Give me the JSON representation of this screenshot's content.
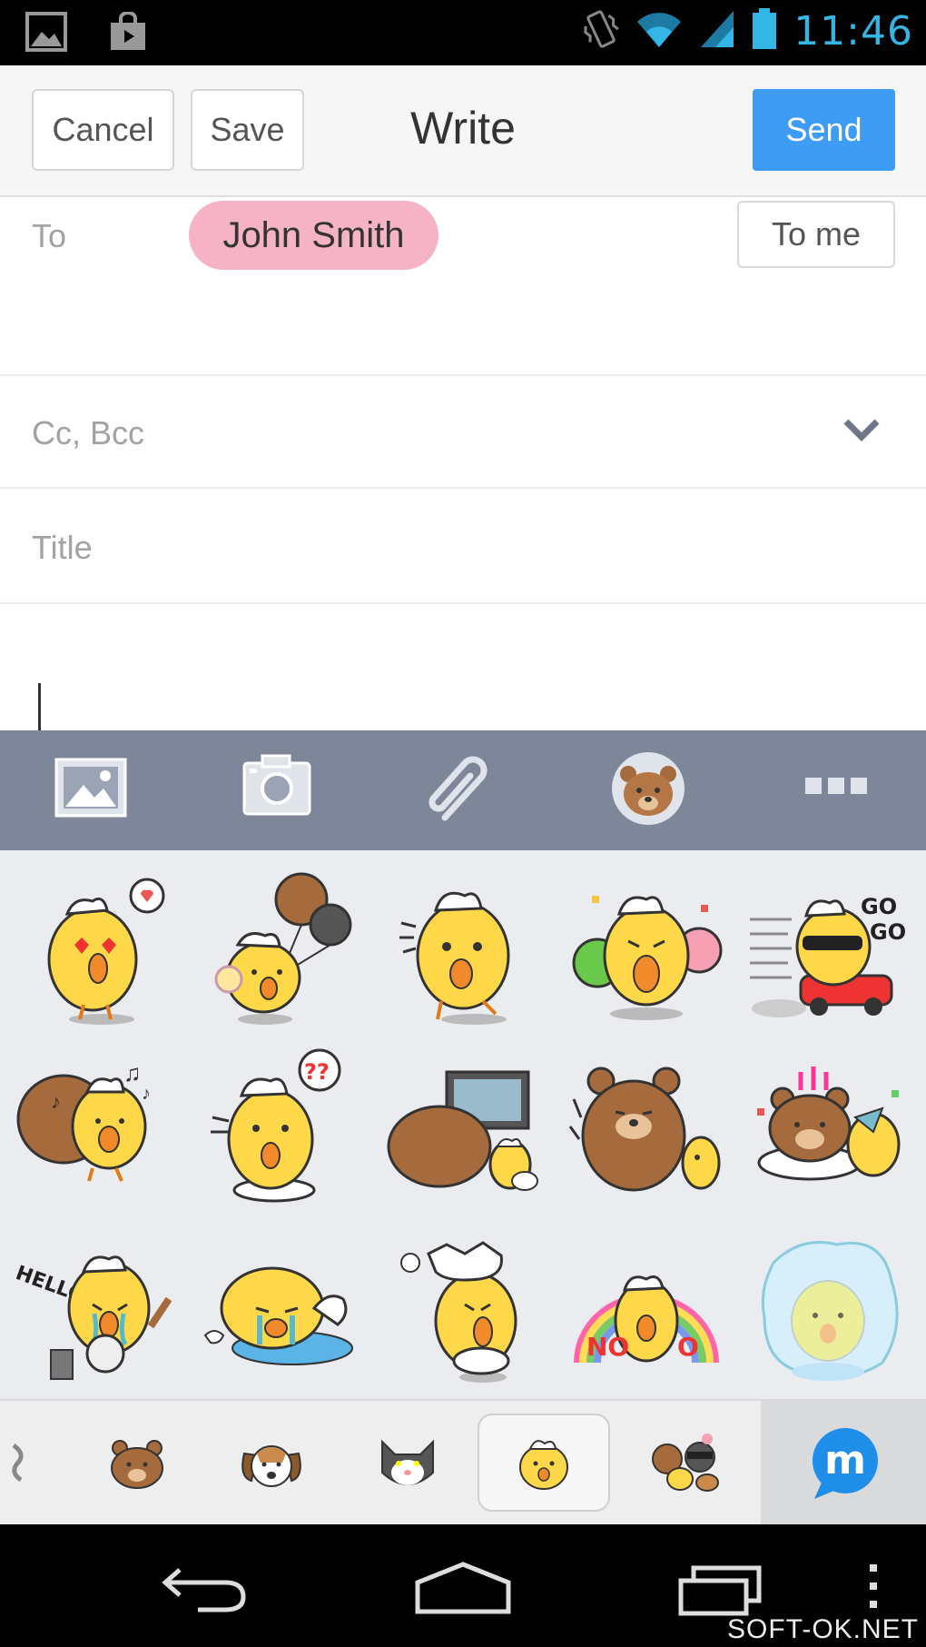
{
  "status_bar": {
    "time": "11:46",
    "icons": [
      "gallery-notification-icon",
      "store-notification-icon",
      "vibrate-icon",
      "wifi-icon",
      "signal-icon",
      "battery-icon"
    ]
  },
  "header": {
    "cancel_label": "Cancel",
    "save_label": "Save",
    "title": "Write",
    "send_label": "Send"
  },
  "form": {
    "to_label": "To",
    "recipient": "John Smith",
    "to_me_label": "To me",
    "cc_bcc_label": "Cc, Bcc",
    "title_placeholder": "Title"
  },
  "toolbar": {
    "items": [
      "image-icon",
      "camera-icon",
      "attachment-icon",
      "sticker-bear-icon",
      "more-icon"
    ]
  },
  "stickers": {
    "rows": 3,
    "columns": 5,
    "items": [
      "chick-heart-eyes-sticker",
      "chick-with-bear-balloons-sticker",
      "chick-shocked-sticker",
      "chick-crying-flowers-sticker",
      "chick-go-go-car-sticker",
      "bear-chick-music-sticker",
      "chick-confused-sticker",
      "bear-chick-tv-sticker",
      "bear-sitting-chick-sticker",
      "bear-chick-cake-sticker",
      "chick-hello-sticker",
      "chick-puddle-crying-sticker",
      "chick-egg-hat-sticker",
      "chick-no-rainbow-sticker",
      "chick-bubble-sticker"
    ],
    "texts": {
      "go": "GO",
      "hello": "HELLO",
      "no": "NO"
    }
  },
  "sticker_tabs": {
    "items": [
      "bear-tab-icon",
      "dog-tab-icon",
      "cat-tab-icon",
      "chick-tab-icon",
      "group-tab-icon"
    ],
    "selected": "chick-tab-icon",
    "app_icon": "m-messenger-icon",
    "app_letter": "m"
  },
  "nav_bar": {
    "items": [
      "back-icon",
      "home-icon",
      "recents-icon",
      "menu-icon"
    ]
  },
  "watermark": "SOFT-OK.NET",
  "colors": {
    "send": "#3f9cf5",
    "chip": "#f7b3c6",
    "toolbar": "#7d8799",
    "status_time": "#33b5e5",
    "chick": "#ffd84a"
  }
}
